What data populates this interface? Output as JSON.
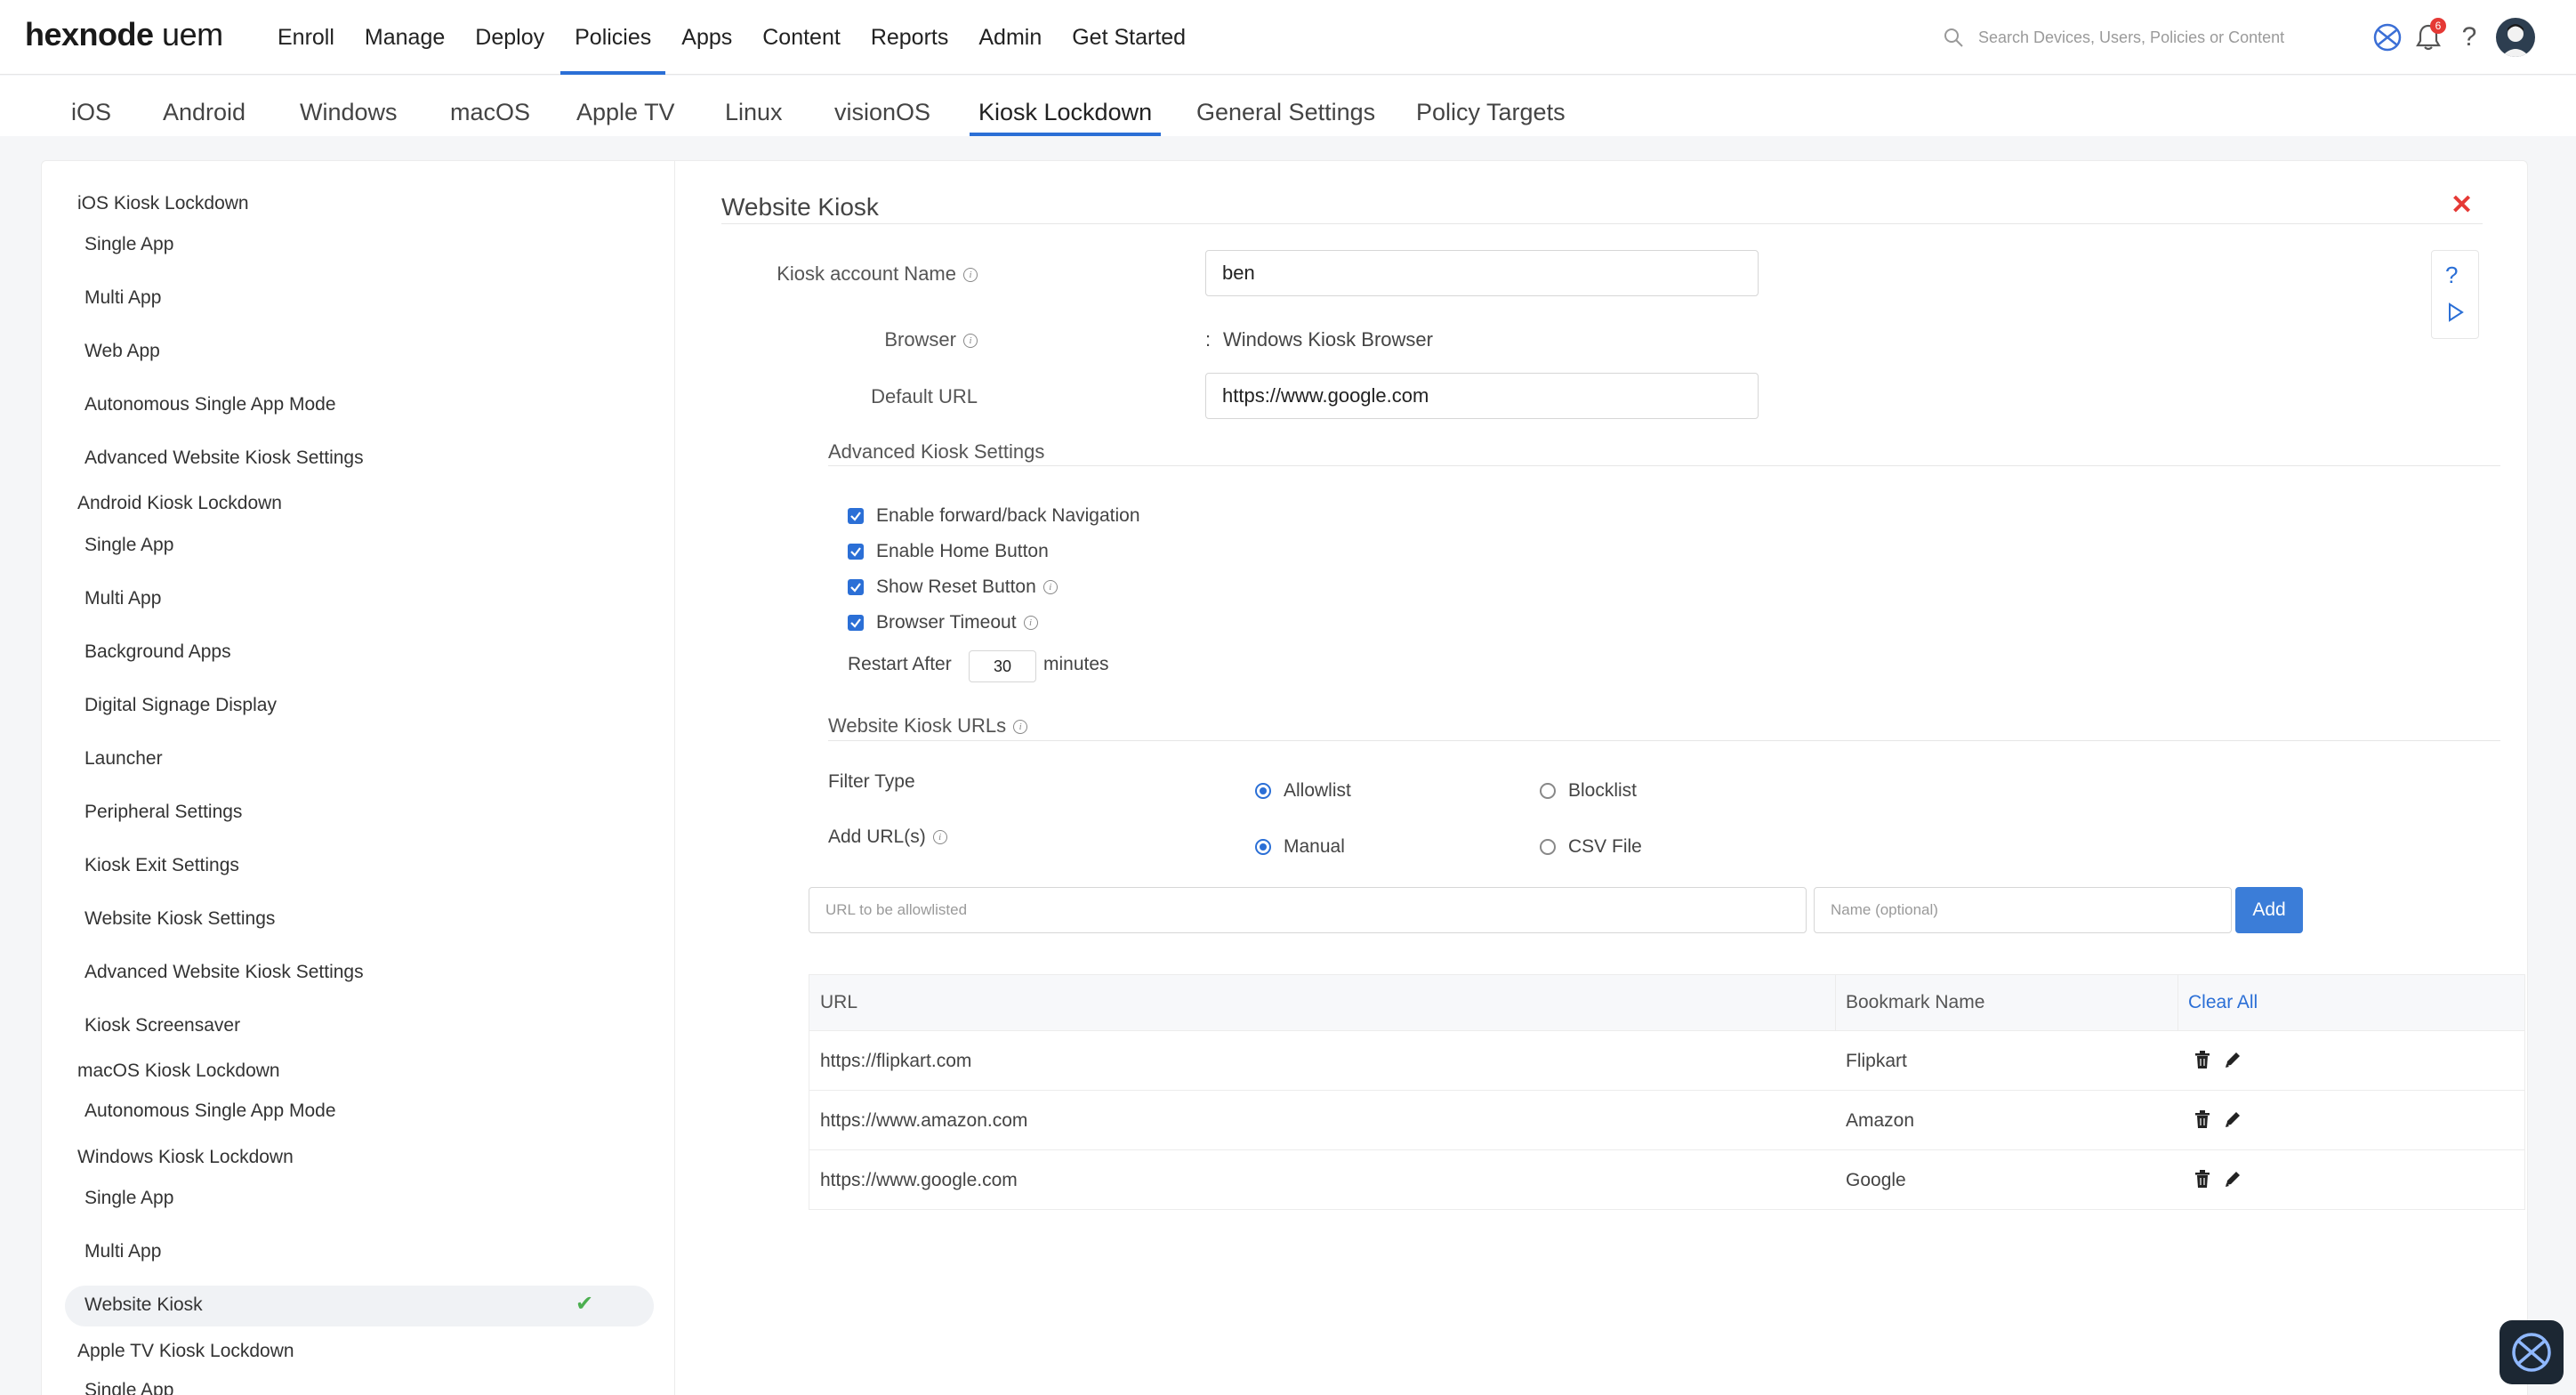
{
  "brand": {
    "name": "hexnode",
    "product": "uem"
  },
  "nav": {
    "items": [
      "Enroll",
      "Manage",
      "Deploy",
      "Policies",
      "Apps",
      "Content",
      "Reports",
      "Admin",
      "Get Started"
    ],
    "active": "Policies"
  },
  "search": {
    "placeholder": "Search Devices, Users, Policies or Content"
  },
  "notifications": {
    "count": "6"
  },
  "platform_tabs": {
    "items": [
      "iOS",
      "Android",
      "Windows",
      "macOS",
      "Apple TV",
      "Linux",
      "visionOS",
      "Kiosk Lockdown",
      "General Settings",
      "Policy Targets"
    ],
    "active": "Kiosk Lockdown"
  },
  "sidebar": {
    "groups": [
      {
        "title": "iOS Kiosk Lockdown",
        "items": [
          "Single App",
          "Multi App",
          "Web App",
          "Autonomous Single App Mode",
          "Advanced Website Kiosk Settings"
        ]
      },
      {
        "title": "Android Kiosk Lockdown",
        "items": [
          "Single App",
          "Multi App",
          "Background Apps",
          "Digital Signage Display",
          "Launcher",
          "Peripheral Settings",
          "Kiosk Exit Settings",
          "Website Kiosk Settings",
          "Advanced Website Kiosk Settings",
          "Kiosk Screensaver"
        ]
      },
      {
        "title": "macOS Kiosk Lockdown",
        "items": [
          "Autonomous Single App Mode"
        ]
      },
      {
        "title": "Windows Kiosk Lockdown",
        "items": [
          "Single App",
          "Multi App",
          "Website Kiosk"
        ]
      },
      {
        "title": "Apple TV Kiosk Lockdown",
        "items": [
          "Single App"
        ]
      }
    ],
    "selected": "Website Kiosk"
  },
  "form": {
    "section_title": "Website Kiosk",
    "kiosk_account_label": "Kiosk account Name",
    "kiosk_account_value": "ben",
    "browser_label": "Browser",
    "browser_sep": ":",
    "browser_value": "Windows Kiosk Browser",
    "default_url_label": "Default URL",
    "default_url_value": "https://www.google.com",
    "advanced_title": "Advanced Kiosk Settings",
    "checkboxes": [
      "Enable forward/back Navigation",
      "Enable Home Button",
      "Show Reset Button",
      "Browser Timeout"
    ],
    "restart_label": "Restart After",
    "restart_value": "30",
    "restart_unit": "minutes",
    "urls_title": "Website Kiosk URLs",
    "filter_type_label": "Filter Type",
    "filter_options": [
      "Allowlist",
      "Blocklist"
    ],
    "filter_selected": "Allowlist",
    "add_urls_label": "Add URL(s)",
    "add_options": [
      "Manual",
      "CSV File"
    ],
    "add_selected": "Manual",
    "url_placeholder": "URL to be allowlisted",
    "name_placeholder": "Name (optional)",
    "add_button": "Add"
  },
  "table": {
    "headers": {
      "url": "URL",
      "bookmark": "Bookmark Name",
      "clear": "Clear All"
    },
    "rows": [
      {
        "url": "https://flipkart.com",
        "name": "Flipkart"
      },
      {
        "url": "https://www.amazon.com",
        "name": "Amazon"
      },
      {
        "url": "https://www.google.com",
        "name": "Google"
      }
    ]
  },
  "colors": {
    "accent": "#2b6fd6",
    "danger": "#e53935",
    "success": "#4caf50"
  }
}
